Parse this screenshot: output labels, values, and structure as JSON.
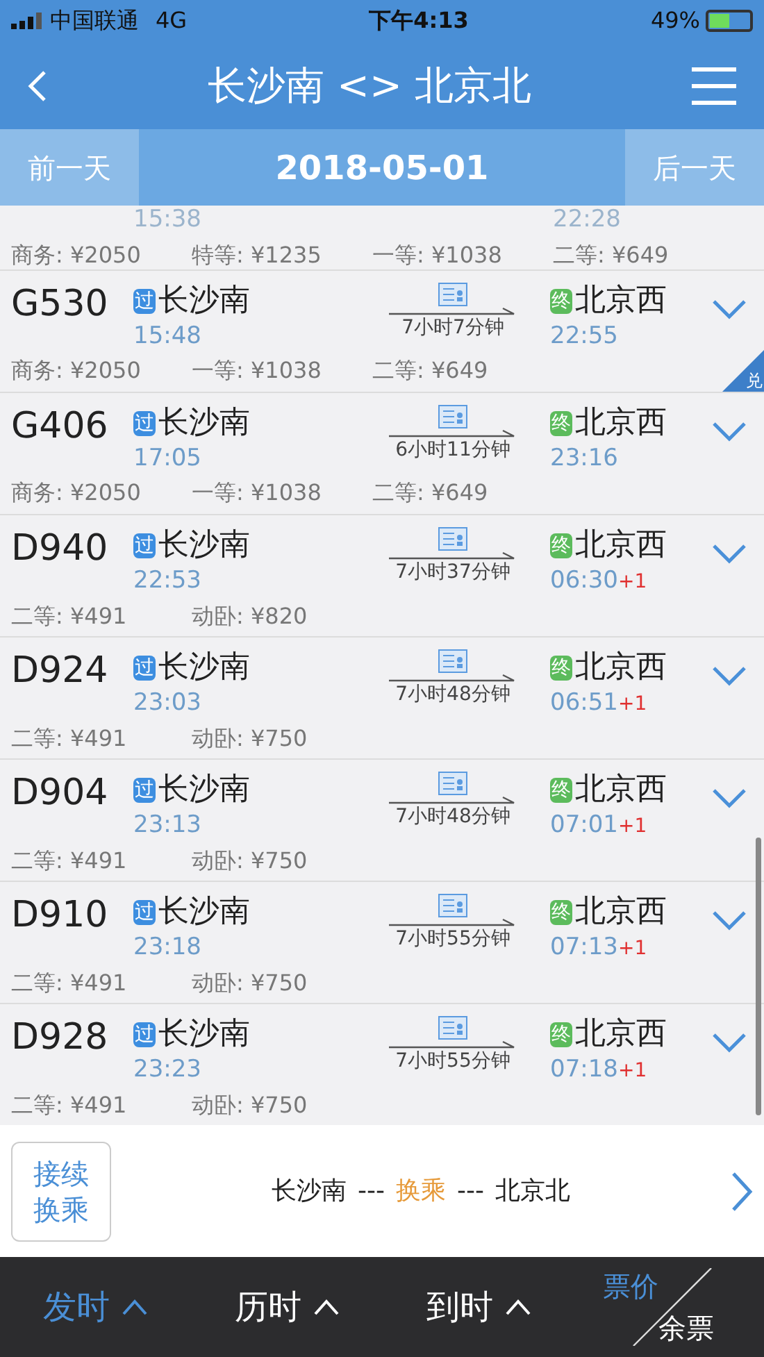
{
  "status_bar": {
    "carrier": "中国联通",
    "network": "4G",
    "time": "下午4:13",
    "battery": "49%"
  },
  "header": {
    "title": "长沙南 <> 北京北"
  },
  "date_bar": {
    "prev": "前一天",
    "date": "2018-05-01",
    "next": "后一天"
  },
  "partial_row": {
    "depart_time": "15:38",
    "arrive_time": "22:28",
    "prices": [
      "商务: ¥2050",
      "特等: ¥1235",
      "一等: ¥1038",
      "二等: ¥649"
    ]
  },
  "trains": [
    {
      "number": "G530",
      "from_badge": "过",
      "from": "长沙南",
      "depart_time": "15:48",
      "duration": "7小时7分钟",
      "to_badge": "终",
      "to": "北京西",
      "arrive_time": "22:55",
      "prices": [
        "商务: ¥2050",
        "一等: ¥1038",
        "二等: ¥649"
      ],
      "corner_badge": "兑"
    },
    {
      "number": "G406",
      "from_badge": "过",
      "from": "长沙南",
      "depart_time": "17:05",
      "duration": "6小时11分钟",
      "to_badge": "终",
      "to": "北京西",
      "arrive_time": "23:16",
      "prices": [
        "商务: ¥2050",
        "一等: ¥1038",
        "二等: ¥649"
      ]
    },
    {
      "number": "D940",
      "from_badge": "过",
      "from": "长沙南",
      "depart_time": "22:53",
      "duration": "7小时37分钟",
      "to_badge": "终",
      "to": "北京西",
      "arrive_time": "06:30",
      "next_day": "+1",
      "prices": [
        "二等: ¥491",
        "动卧: ¥820"
      ]
    },
    {
      "number": "D924",
      "from_badge": "过",
      "from": "长沙南",
      "depart_time": "23:03",
      "duration": "7小时48分钟",
      "to_badge": "终",
      "to": "北京西",
      "arrive_time": "06:51",
      "next_day": "+1",
      "prices": [
        "二等: ¥491",
        "动卧: ¥750"
      ]
    },
    {
      "number": "D904",
      "from_badge": "过",
      "from": "长沙南",
      "depart_time": "23:13",
      "duration": "7小时48分钟",
      "to_badge": "终",
      "to": "北京西",
      "arrive_time": "07:01",
      "next_day": "+1",
      "prices": [
        "二等: ¥491",
        "动卧: ¥750"
      ]
    },
    {
      "number": "D910",
      "from_badge": "过",
      "from": "长沙南",
      "depart_time": "23:18",
      "duration": "7小时55分钟",
      "to_badge": "终",
      "to": "北京西",
      "arrive_time": "07:13",
      "next_day": "+1",
      "prices": [
        "二等: ¥491",
        "动卧: ¥750"
      ]
    },
    {
      "number": "D928",
      "from_badge": "过",
      "from": "长沙南",
      "depart_time": "23:23",
      "duration": "7小时55分钟",
      "to_badge": "终",
      "to": "北京西",
      "arrive_time": "07:18",
      "next_day": "+1",
      "prices": [
        "二等: ¥491",
        "动卧: ¥750"
      ]
    }
  ],
  "transfer": {
    "button": [
      "接续",
      "换乘"
    ],
    "from": "长沙南",
    "dash_1": "---",
    "middle": "换乘",
    "dash_2": "---",
    "to": "北京北"
  },
  "sort_bar": [
    {
      "kind": "sort",
      "label": "发时",
      "selected": true
    },
    {
      "kind": "sort",
      "label": "历时",
      "selected": false
    },
    {
      "kind": "sort",
      "label": "到时",
      "selected": false
    },
    {
      "kind": "split",
      "top": "票价",
      "bottom": "余票",
      "selected": true
    }
  ]
}
